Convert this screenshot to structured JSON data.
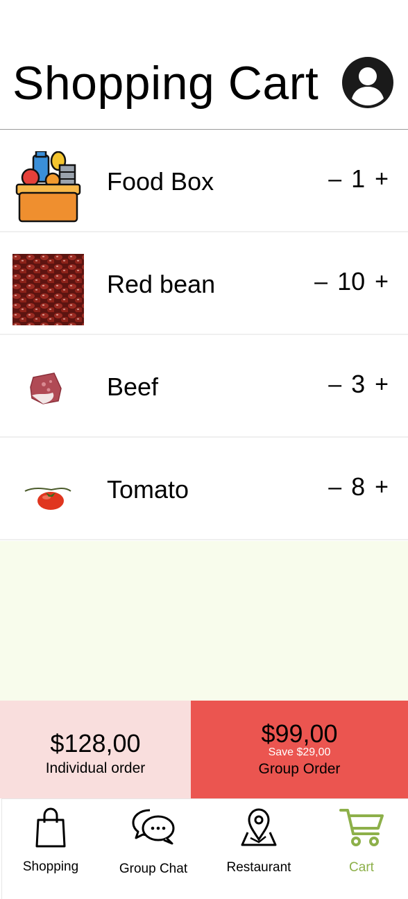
{
  "header": {
    "title": "Shopping Cart",
    "avatar_icon": "user-circle-icon"
  },
  "cart": {
    "items": [
      {
        "name": "Food Box",
        "quantity": "1",
        "icon": "food-box-icon"
      },
      {
        "name": "Red bean",
        "quantity": "10",
        "icon": "red-bean-image"
      },
      {
        "name": "Beef",
        "quantity": "3",
        "icon": "beef-image"
      },
      {
        "name": "Tomato",
        "quantity": "8",
        "icon": "tomato-image"
      }
    ],
    "minus_label": "–",
    "plus_label": "+"
  },
  "order": {
    "individual": {
      "price": "$128,00",
      "label": "Individual order"
    },
    "group": {
      "price": "$99,00",
      "save": "Save $29,00",
      "label": "Group Order"
    }
  },
  "tabs": [
    {
      "label": "Shopping",
      "icon": "shopping-bag-icon"
    },
    {
      "label": "Group Chat",
      "icon": "chat-bubbles-icon"
    },
    {
      "label": "Restaurant",
      "icon": "map-pin-icon"
    },
    {
      "label": "Cart",
      "icon": "cart-icon",
      "active": true
    }
  ],
  "colors": {
    "filler": "#f8fcec",
    "individual_bg": "#f9dedd",
    "group_bg": "#eb5550",
    "active_tab": "#8db04a"
  }
}
